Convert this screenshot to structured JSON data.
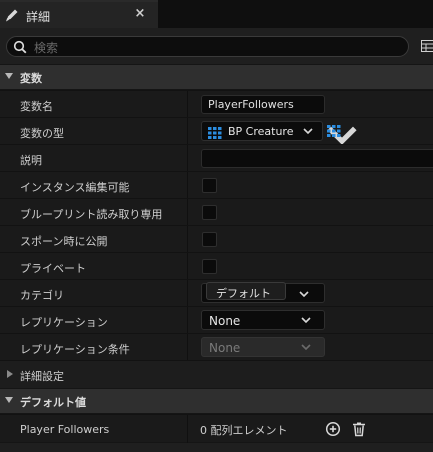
{
  "tab": {
    "title": "詳細",
    "close": "×",
    "icon": "pencil-icon"
  },
  "search": {
    "placeholder": "検索",
    "icon": "search-icon",
    "view_icon": "grid-view-icon"
  },
  "sections": {
    "variables": "変数",
    "advanced": "詳細設定",
    "default_value": "デフォルト値"
  },
  "properties": {
    "variable_name": {
      "label": "変数名",
      "value": "PlayerFollowers"
    },
    "variable_type": {
      "label": "変数の型",
      "value": "BP Creature",
      "type_icon": "grid-array-icon",
      "container_icon": "grid-array-icon"
    },
    "description": {
      "label": "説明",
      "value": ""
    },
    "instance_editable": {
      "label": "インスタンス編集可能",
      "checked": false
    },
    "blueprint_readonly": {
      "label": "ブループリント読み取り専用",
      "checked": false
    },
    "expose_on_spawn": {
      "label": "スポーン時に公開",
      "checked": false
    },
    "private": {
      "label": "プライベート",
      "checked": false
    },
    "category": {
      "label": "カテゴリ",
      "value": "デフォルト"
    },
    "replication": {
      "label": "レプリケーション",
      "value": "None"
    },
    "replication_condition": {
      "label": "レプリケーション条件",
      "value": "None"
    }
  },
  "defaults": {
    "player_followers": {
      "label": "Player Followers",
      "value": "0 配列エレメント",
      "add_icon": "add-circle-icon",
      "delete_icon": "trash-icon"
    }
  },
  "colors": {
    "accent_blue": "#2b8de0",
    "panel": "#1a1a1a",
    "header": "#2f2f2f"
  }
}
